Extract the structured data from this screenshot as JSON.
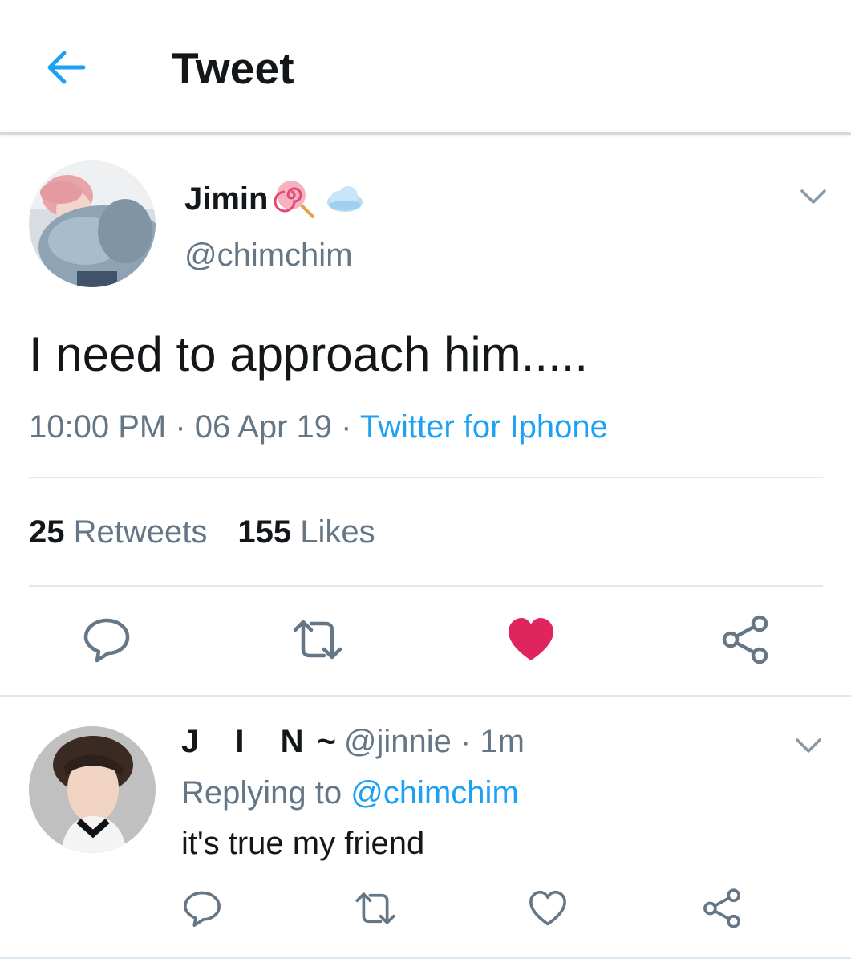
{
  "header": {
    "title": "Tweet"
  },
  "tweet": {
    "author_name": "Jimin",
    "author_handle": "@chimchim",
    "text": "I need to approach him.....",
    "time": "10:00 PM",
    "date": "06 Apr 19",
    "separator": " · ",
    "source": "Twitter for Iphone",
    "retweet_count": "25",
    "retweet_label": "Retweets",
    "like_count": "155",
    "like_label": "Likes",
    "liked": true,
    "icons": [
      "lollipop-emoji",
      "cloud-emoji",
      "chevron-down-icon",
      "reply-icon",
      "retweet-icon",
      "heart-filled-icon",
      "share-icon"
    ]
  },
  "reply": {
    "author_name": "J I N",
    "tilde": "~",
    "author_handle": "@jinnie",
    "time_ago": "1m",
    "separator": " · ",
    "replying_prefix": "Replying to",
    "replying_to": "@chimchim",
    "text": "it's true my friend",
    "icons": [
      "chevron-down-icon",
      "reply-icon",
      "retweet-icon",
      "heart-outline-icon",
      "share-icon"
    ]
  },
  "colors": {
    "accent": "#1da1f2",
    "like": "#e0245e",
    "text_primary": "#14171a",
    "text_secondary": "#657786",
    "icon_gray": "#657786",
    "divider": "#e1e8ed"
  }
}
